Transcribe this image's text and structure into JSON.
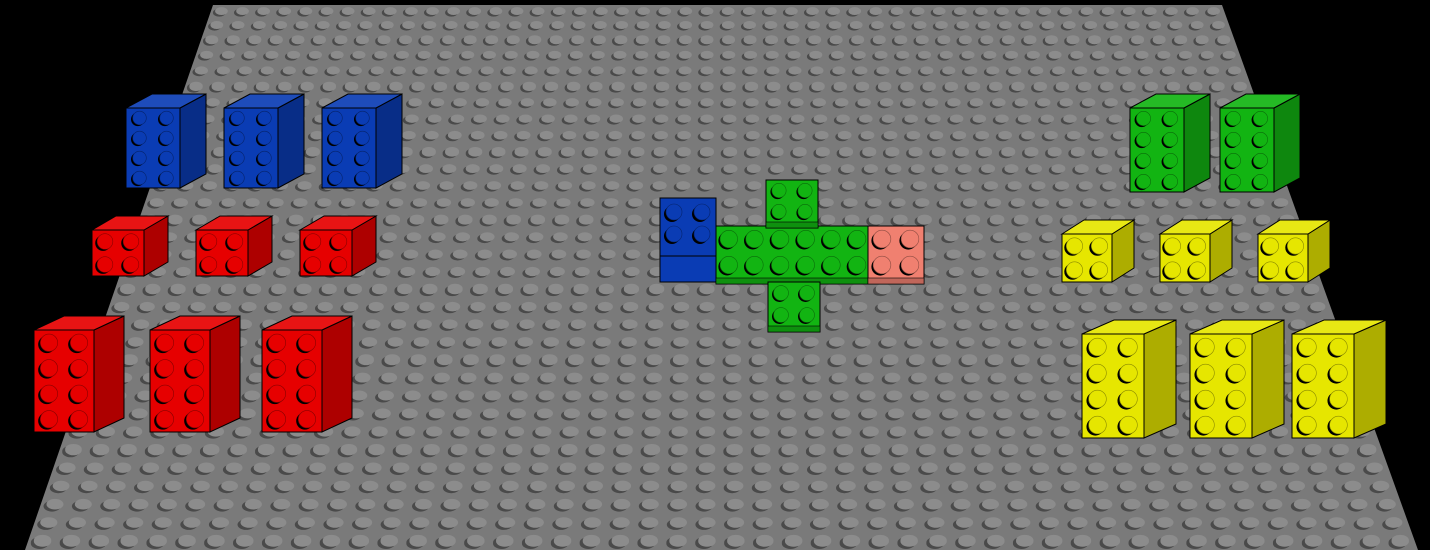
{
  "scene": {
    "background_color": "#000000",
    "baseplate": {
      "color": "#7a7a7a",
      "stud_color": "#8c8c8c",
      "stud_shadow_color": "#4a4a4a",
      "studs_across": 48,
      "studs_deep": 32
    },
    "colors": {
      "blue": "#0a3cb4",
      "red": "#e60000",
      "green": "#12b412",
      "yellow": "#e6e600",
      "salmon": "#f08070"
    },
    "inventory": {
      "left": {
        "blue_2x4_bricks": 3,
        "red_2x2_bricks": 3,
        "red_2x4_bricks": 3
      },
      "right": {
        "green_2x4_bricks": 2,
        "yellow_2x2_bricks": 3,
        "yellow_2x4_bricks": 3
      }
    },
    "assembly": {
      "description_parts": [
        "blue",
        "green",
        "green",
        "green",
        "salmon"
      ]
    }
  }
}
